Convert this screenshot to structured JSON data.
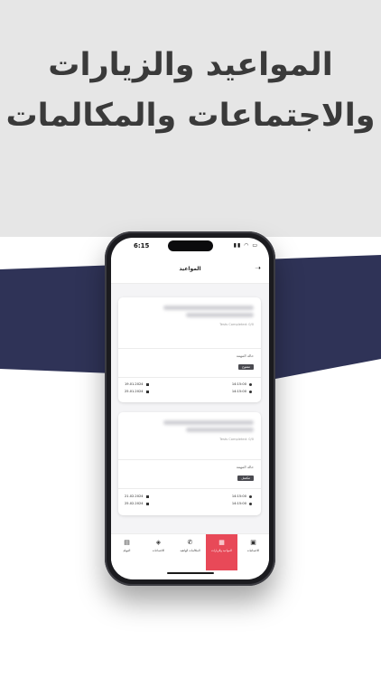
{
  "promo": {
    "headline_line1": "المواعيد والزيارات",
    "headline_line2": "والاجتماعات والمكالمات"
  },
  "device": {
    "status_time": "6:15",
    "status_icons": "▮▮ ◠ ▭"
  },
  "app": {
    "title": "المواعيد",
    "back_icon": "arrow-right-icon"
  },
  "appointments": [
    {
      "tests_text": "Tests Completed: 0/0",
      "status_label": "حالة المهمة",
      "status_value": "مفتوح",
      "start_date": "19.01.2024",
      "end_date": "25.01.2024",
      "start_time": "14:15:00",
      "end_time": "14:15:00"
    },
    {
      "tests_text": "Tests Completed: 0/0",
      "status_label": "حالة المهمة",
      "status_value": "مكتمل",
      "start_date": "21.02.2024",
      "end_date": "25.02.2024",
      "start_time": "14:15:00",
      "end_time": "14:15:00"
    }
  ],
  "nav": [
    {
      "label": "الاحصائيات",
      "icon": "stats-icon",
      "active": false
    },
    {
      "label": "المواعيد والزيارات",
      "icon": "calendar-icon",
      "active": true
    },
    {
      "label": "المكالمات الهاتفية",
      "icon": "phone-icon",
      "active": false
    },
    {
      "label": "الاجتماعات",
      "icon": "handshake-icon",
      "active": false
    },
    {
      "label": "المهام",
      "icon": "tasks-icon",
      "active": false
    }
  ],
  "colors": {
    "accent": "#e84958",
    "navy": "#2f3357",
    "header_bg": "#e6e6e6"
  }
}
